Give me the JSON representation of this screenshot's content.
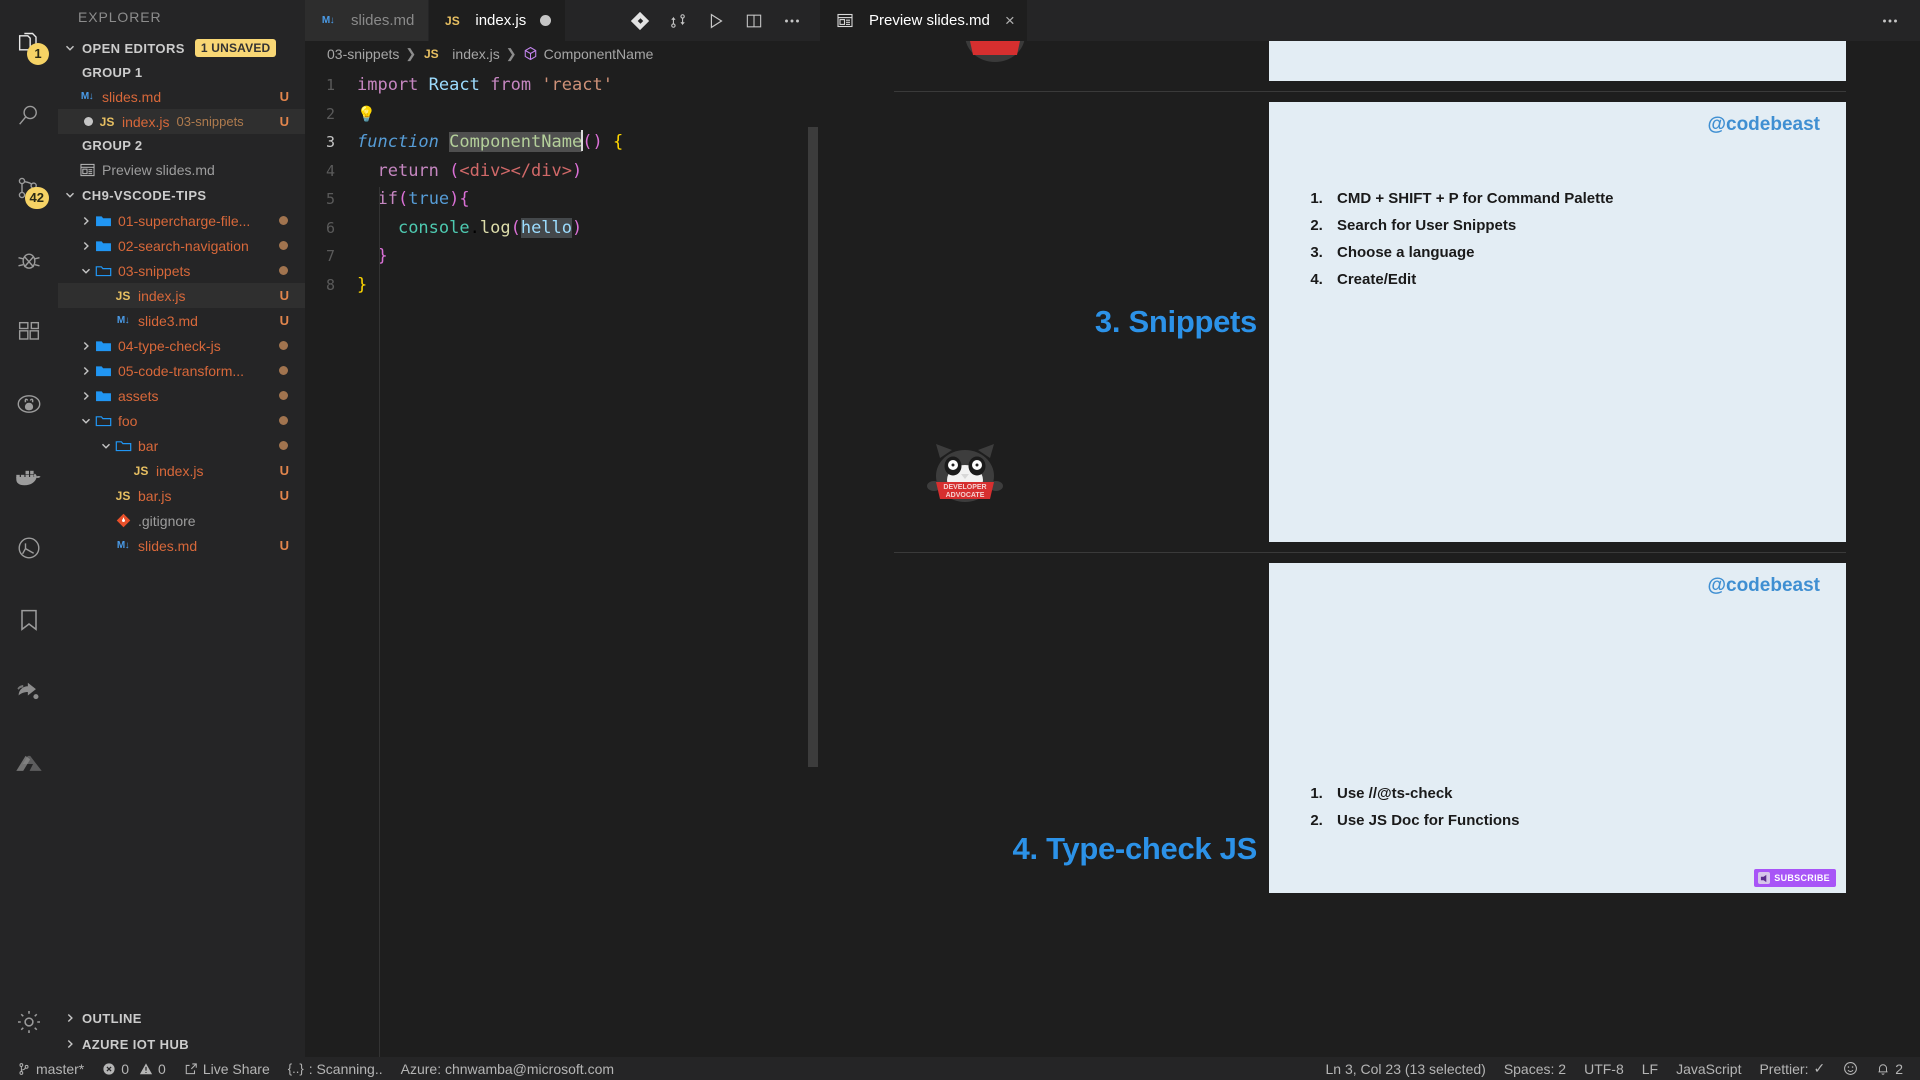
{
  "activitybar": {
    "items": [
      {
        "name": "explorer",
        "icon": "files-icon",
        "badge": "1"
      },
      {
        "name": "search",
        "icon": "search-icon",
        "badge": ""
      },
      {
        "name": "source-control",
        "icon": "source-control-icon",
        "badge": "42"
      },
      {
        "name": "debug",
        "icon": "debug-icon",
        "badge": ""
      },
      {
        "name": "extensions",
        "icon": "extensions-icon",
        "badge": ""
      },
      {
        "name": "github",
        "icon": "github-icon",
        "badge": ""
      },
      {
        "name": "docker",
        "icon": "docker-icon",
        "badge": ""
      },
      {
        "name": "test",
        "icon": "beaker-icon",
        "badge": ""
      },
      {
        "name": "bookmarks",
        "icon": "bookmark-icon",
        "badge": ""
      },
      {
        "name": "live-share",
        "icon": "live-share-icon",
        "badge": ""
      },
      {
        "name": "azure",
        "icon": "azure-icon",
        "badge": ""
      }
    ],
    "bottom": [
      {
        "name": "settings",
        "icon": "gear-icon"
      }
    ]
  },
  "sidebar": {
    "title": "EXPLORER",
    "open_editors": {
      "label": "OPEN EDITORS",
      "badge": "1 UNSAVED",
      "expanded": true,
      "groups": [
        {
          "label": "GROUP 1",
          "items": [
            {
              "name": "slides.md",
              "icon": "markdown-icon",
              "dirty": false,
              "flag": "U",
              "selected": false,
              "sub": ""
            },
            {
              "name": "index.js",
              "icon": "js-icon",
              "dirty": true,
              "flag": "U",
              "selected": true,
              "sub": "03-snippets"
            }
          ]
        },
        {
          "label": "GROUP 2",
          "items": [
            {
              "name": "Preview slides.md",
              "icon": "preview-icon",
              "dirty": false,
              "flag": "",
              "selected": false,
              "sub": ""
            }
          ]
        }
      ]
    },
    "workspace": {
      "label": "CH9-VSCODE-TIPS",
      "expanded": true,
      "tree": [
        {
          "label": "01-supercharge-file...",
          "kind": "folder",
          "depth": 1,
          "expanded": false,
          "flag": "",
          "modified": true,
          "selected": false
        },
        {
          "label": "02-search-navigation",
          "kind": "folder",
          "depth": 1,
          "expanded": false,
          "flag": "",
          "modified": true,
          "selected": false
        },
        {
          "label": "03-snippets",
          "kind": "folder",
          "depth": 1,
          "expanded": true,
          "flag": "",
          "modified": true,
          "selected": false
        },
        {
          "label": "index.js",
          "kind": "js",
          "depth": 2,
          "expanded": false,
          "flag": "U",
          "modified": false,
          "selected": true
        },
        {
          "label": "slide3.md",
          "kind": "md",
          "depth": 2,
          "expanded": false,
          "flag": "U",
          "modified": false,
          "selected": false
        },
        {
          "label": "04-type-check-js",
          "kind": "folder",
          "depth": 1,
          "expanded": false,
          "flag": "",
          "modified": true,
          "selected": false
        },
        {
          "label": "05-code-transform...",
          "kind": "folder",
          "depth": 1,
          "expanded": false,
          "flag": "",
          "modified": true,
          "selected": false
        },
        {
          "label": "assets",
          "kind": "folder",
          "depth": 1,
          "expanded": false,
          "flag": "",
          "modified": true,
          "selected": false
        },
        {
          "label": "foo",
          "kind": "folder",
          "depth": 1,
          "expanded": true,
          "flag": "",
          "modified": true,
          "selected": false
        },
        {
          "label": "bar",
          "kind": "folder",
          "depth": 2,
          "expanded": true,
          "flag": "",
          "modified": true,
          "selected": false
        },
        {
          "label": "index.js",
          "kind": "js",
          "depth": 3,
          "expanded": false,
          "flag": "U",
          "modified": false,
          "selected": false
        },
        {
          "label": "bar.js",
          "kind": "js",
          "depth": 2,
          "expanded": false,
          "flag": "U",
          "modified": false,
          "selected": false
        },
        {
          "label": ".gitignore",
          "kind": "git",
          "depth": 2,
          "expanded": false,
          "flag": "",
          "modified": false,
          "selected": false
        },
        {
          "label": "slides.md",
          "kind": "md",
          "depth": 2,
          "expanded": false,
          "flag": "U",
          "modified": false,
          "selected": false
        }
      ]
    },
    "bottom_sections": [
      {
        "label": "OUTLINE",
        "expanded": false
      },
      {
        "label": "AZURE IOT HUB",
        "expanded": false
      }
    ]
  },
  "editor": {
    "tabs": [
      {
        "label": "slides.md",
        "icon": "markdown-icon",
        "active": false,
        "dirty": false
      },
      {
        "label": "index.js",
        "icon": "js-icon",
        "active": true,
        "dirty": true
      }
    ],
    "tab_actions": [
      {
        "name": "source-control-action",
        "icon": "git-compare-icon"
      },
      {
        "name": "split-compare-action",
        "icon": "compare-changes-icon"
      },
      {
        "name": "run-action",
        "icon": "play-icon"
      },
      {
        "name": "split-editor-action",
        "icon": "split-editor-icon"
      },
      {
        "name": "more-actions",
        "icon": "ellipsis-icon"
      }
    ],
    "breadcrumb": [
      "03-snippets",
      "index.js",
      "ComponentName"
    ],
    "code_lines": [
      {
        "n": "1",
        "current": false
      },
      {
        "n": "2",
        "current": false
      },
      {
        "n": "3",
        "current": true
      },
      {
        "n": "4",
        "current": false
      },
      {
        "n": "5",
        "current": false
      },
      {
        "n": "6",
        "current": false
      },
      {
        "n": "7",
        "current": false
      },
      {
        "n": "8",
        "current": false
      }
    ],
    "code_text": [
      "import React from 'react'",
      "",
      "function ComponentName() {",
      "  return (<div></div>)",
      "  if(true){",
      "    console.log(hello)",
      "  }",
      "}"
    ],
    "selected_text": "ComponentName"
  },
  "preview": {
    "tab": {
      "label": "Preview slides.md",
      "icon": "preview-icon",
      "close": "×"
    },
    "more_icon": "ellipsis-icon",
    "handle": "@codebeast",
    "slides": [
      {
        "title": "3. Snippets",
        "items": [
          "CMD + SHIFT + P for Command Palette",
          "Search for User Snippets",
          "Choose a language",
          "Create/Edit"
        ]
      },
      {
        "title": "4. Type-check JS",
        "items": [
          "Use //@ts-check",
          "Use JS Doc for Functions"
        ]
      }
    ],
    "mascot_text": [
      "DEVELOPER",
      "ADVOCATE"
    ],
    "subscribe_label": "SUBSCRIBE"
  },
  "statusbar": {
    "left": [
      {
        "name": "branch",
        "icon": "source-control-icon",
        "label": "master*"
      },
      {
        "name": "problems",
        "icon": "error-warning-icon",
        "label": "0",
        "label2": "0"
      },
      {
        "name": "live-share",
        "icon": "live-share-icon",
        "label": "Live Share"
      },
      {
        "name": "bracket-scan",
        "icon": "braces-icon",
        "label": ": Scanning.."
      },
      {
        "name": "azure-account",
        "icon": "",
        "label": "Azure: chnwamba@microsoft.com"
      }
    ],
    "right": [
      {
        "name": "cursor-position",
        "label": "Ln 3, Col 23 (13 selected)"
      },
      {
        "name": "indentation",
        "label": "Spaces: 2"
      },
      {
        "name": "encoding",
        "label": "UTF-8"
      },
      {
        "name": "eol",
        "label": "LF"
      },
      {
        "name": "language-mode",
        "label": "JavaScript"
      },
      {
        "name": "prettier",
        "label": "Prettier:",
        "check": "✓"
      },
      {
        "name": "feedback",
        "label": "",
        "icon": "smiley-icon"
      },
      {
        "name": "notifications",
        "label": "2",
        "icon": "bell-icon"
      }
    ]
  },
  "colors": {
    "accent_blue": "#2c92e8",
    "badge_yellow": "#f6d365",
    "modified_orange": "#d8683a",
    "slide_bg": "#e3edf4",
    "editor_bg": "#1e1e1e",
    "chrome_bg": "#252526"
  }
}
